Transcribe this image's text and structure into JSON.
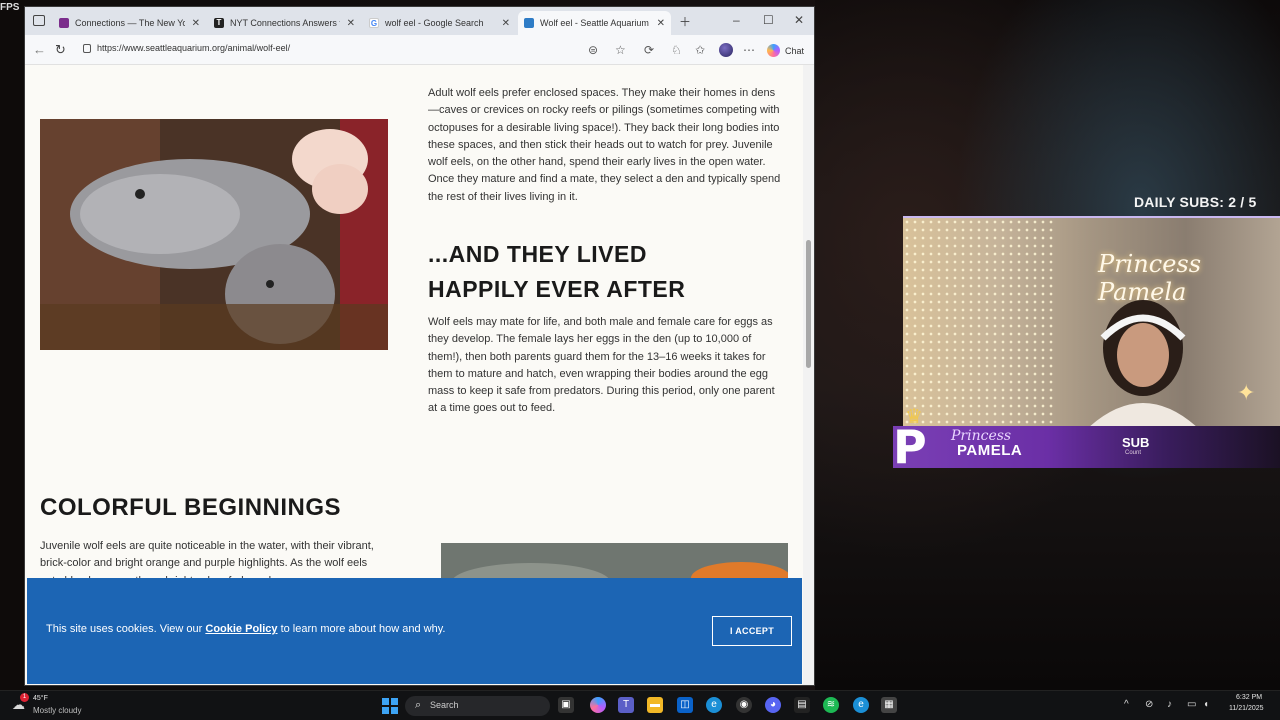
{
  "overlay": {
    "fps_label": "FPS",
    "daily_subs": "DAILY SUBS:  2 / 5",
    "cam_sign": "Princess Pamela",
    "banner_script": "Princess",
    "banner_name": "PAMELA",
    "banner_letter": "P",
    "banner_sub": "SUB",
    "banner_sub_small": "Count"
  },
  "browser": {
    "tabs": [
      {
        "title": "Connections — The New York Ti",
        "favicon": "nyt-icon",
        "active": false
      },
      {
        "title": "NYT Connections Answers for N",
        "favicon": "nyt-icon",
        "active": false
      },
      {
        "title": "wolf eel - Google Search",
        "favicon": "google-icon",
        "active": false
      },
      {
        "title": "Wolf eel - Seattle Aquarium",
        "favicon": "aquarium-icon",
        "active": true
      }
    ],
    "url": "https://www.seattleaquarium.org/animal/wolf-eel/",
    "chat_label": "Chat"
  },
  "page": {
    "para_dens": "Adult wolf eels prefer enclosed spaces. They make their homes in dens—caves or crevices on rocky reefs or pilings (sometimes competing with octopuses for a desirable living space!). They back their long bodies into these spaces, and then stick their heads out to watch for prey. Juvenile wolf eels, on the other hand, spend their early lives in the open water. Once they mature and find a mate, they select a den and typically spend the rest of their lives living in it.",
    "heading_lived_1": "...AND THEY LIVED",
    "heading_lived_2": "HAPPILY EVER AFTER",
    "para_mate": "Wolf eels may mate for life, and both male and female care for eggs as they develop. The female lays her eggs in the den (up to 10,000 of them!), then both parents guard them for the 13–16 weeks it takes for them to mature and hatch, even wrapping their bodies around the egg mass to keep it safe from predators. During this period, only one parent at a time goes out to feed.",
    "heading_colorful": "COLORFUL BEGINNINGS",
    "para_colorful": "Juvenile wolf eels are quite noticeable in the water, with their vibrant, brick-color and bright orange and purple highlights. As the wolf eels get older, however, those bright colors fade and"
  },
  "cookie": {
    "text_before": "This site uses cookies. View our ",
    "link": "Cookie Policy",
    "text_after": " to learn more about how and why.",
    "accept": "I ACCEPT"
  },
  "taskbar": {
    "weather_temp": "45°F",
    "weather_desc": "Mostly cloudy",
    "weather_badge": "1",
    "search_label": "Search",
    "time": "6:32 PM",
    "date": "11/21/2025"
  }
}
